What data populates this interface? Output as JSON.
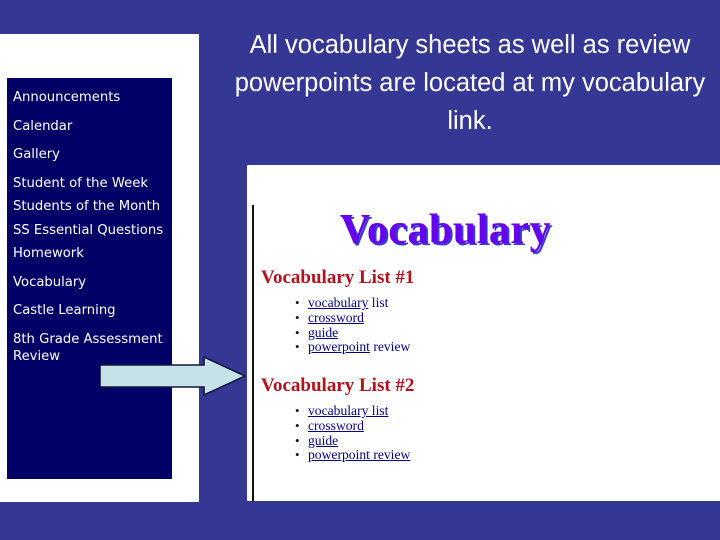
{
  "slide": {
    "background_color": "#353795",
    "caption": "All vocabulary sheets as well as review powerpoints are located at my vocabulary link."
  },
  "left_panel": {
    "background_color": "#ffffff",
    "nav_background_color": "#000066",
    "nav_text_color": "#ffffff",
    "items": [
      {
        "label": "Announcements"
      },
      {
        "label": "Calendar"
      },
      {
        "label": "Gallery"
      },
      {
        "label": "Student of the Week"
      },
      {
        "label": "Students of the Month"
      },
      {
        "label": "SS Essential Questions"
      },
      {
        "label": "Homework"
      },
      {
        "label": "Vocabulary"
      },
      {
        "label": "Castle Learning"
      },
      {
        "label": "8th Grade Assessment Review"
      }
    ]
  },
  "arrow": {
    "name": "pointer-arrow",
    "fill_color": "#c6e2e9",
    "stroke_color": "#15153f",
    "points_to": "Vocabulary"
  },
  "right_panel": {
    "background_color": "#ffffff",
    "page_title": "Vocabulary",
    "page_title_color": "#6600ee",
    "page_title_shadow_color": "#3a3acc",
    "heading_color": "#b5111c",
    "link_color": "#00008b",
    "sections": [
      {
        "heading": "Vocabulary List #1",
        "links": [
          {
            "link_text": "vocabulary",
            "plain_text": " list"
          },
          {
            "link_text": "crossword",
            "plain_text": ""
          },
          {
            "link_text": "guide",
            "plain_text": ""
          },
          {
            "link_text": "powerpoint",
            "plain_text": " review"
          }
        ]
      },
      {
        "heading": "Vocabulary List #2",
        "links": [
          {
            "link_text": "vocabulary list",
            "plain_text": ""
          },
          {
            "link_text": "crossword",
            "plain_text": ""
          },
          {
            "link_text": "guide",
            "plain_text": ""
          },
          {
            "link_text": "powerpoint review",
            "plain_text": ""
          }
        ]
      }
    ]
  }
}
